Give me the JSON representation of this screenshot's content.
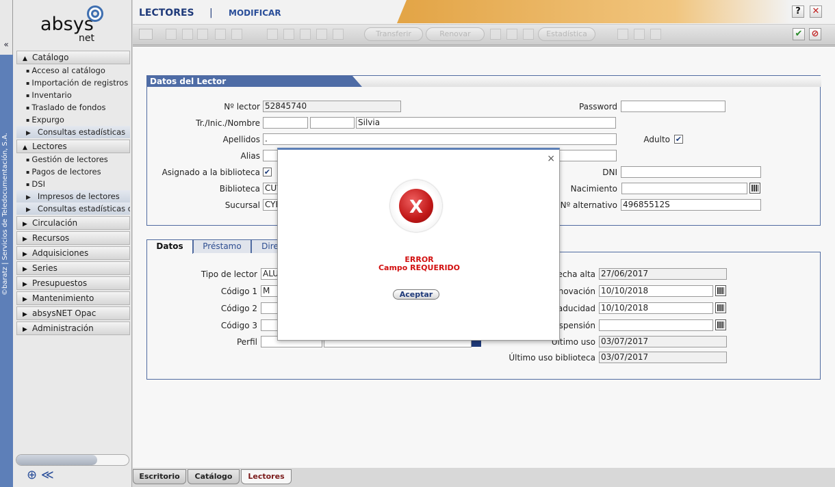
{
  "brand": {
    "name": "absys",
    "suffix": "net",
    "copyright": "©baratz | Servicios de Teledocumentación, S.A."
  },
  "sidebar": {
    "collapse_glyph": "«",
    "sections": [
      {
        "label": "Catálogo",
        "expanded": true,
        "items": [
          {
            "label": "Acceso al catálogo",
            "type": "link"
          },
          {
            "label": "Importación de registros",
            "type": "link"
          },
          {
            "label": "Inventario",
            "type": "link"
          },
          {
            "label": "Traslado de fondos",
            "type": "link"
          },
          {
            "label": "Expurgo",
            "type": "link"
          },
          {
            "label": "Consultas estadísticas",
            "type": "group"
          }
        ]
      },
      {
        "label": "Lectores",
        "expanded": true,
        "items": [
          {
            "label": "Gestión de lectores",
            "type": "link"
          },
          {
            "label": "Pagos de lectores",
            "type": "link"
          },
          {
            "label": "DSI",
            "type": "link"
          },
          {
            "label": "Impresos de lectores",
            "type": "group"
          },
          {
            "label": "Consultas estadísticas d",
            "type": "group"
          }
        ]
      },
      {
        "label": "Circulación",
        "expanded": false
      },
      {
        "label": "Recursos",
        "expanded": false
      },
      {
        "label": "Adquisiciones",
        "expanded": false
      },
      {
        "label": "Series",
        "expanded": false
      },
      {
        "label": "Presupuestos",
        "expanded": false
      },
      {
        "label": "Mantenimiento",
        "expanded": false
      },
      {
        "label": "absysNET Opac",
        "expanded": false
      },
      {
        "label": "Administración",
        "expanded": false
      }
    ]
  },
  "header": {
    "module": "LECTORES",
    "separator": "|",
    "action": "MODIFICAR",
    "help": "?",
    "close": "✕"
  },
  "toolbar": {
    "transferir": "Transferir",
    "renovar": "Renovar",
    "estadistica": "Estadística"
  },
  "lector": {
    "title": "Datos del Lector",
    "n_lector_label": "Nº lector",
    "n_lector": "52845740",
    "password_label": "Password",
    "password": "",
    "nombre_label": "Tr./Inic./Nombre",
    "tr": "",
    "inic": "",
    "nombre": "Silvia",
    "apellidos_label": "Apellidos",
    "apellidos": ".",
    "adulto_label": "Adulto",
    "alias_label": "Alias",
    "alias": "",
    "asignado_label": "Asignado a la biblioteca",
    "dni_label": "DNI",
    "dni": "",
    "biblioteca_label": "Biblioteca",
    "biblioteca": "CUV",
    "nacimiento_label": "Nacimiento",
    "nacimiento": "",
    "sucursal_label": "Sucursal",
    "sucursal": "CYE",
    "n_alt_label": "Nº alternativo",
    "n_alt": "49685512S"
  },
  "tabs": [
    "Datos",
    "Préstamo",
    "Dire"
  ],
  "datos": {
    "tipo_label": "Tipo de lector",
    "tipo": "ALU",
    "codigo1_label": "Código 1",
    "codigo1": "M",
    "codigo2_label": "Código 2",
    "codigo2": "",
    "codigo3_label": "Código 3",
    "codigo3": "",
    "perfil_label": "Perfil",
    "perfil": "",
    "alta_label": "echa alta",
    "alta": "27/06/2017",
    "renov_label": "enovación",
    "renov": "10/10/2018",
    "cad_label": "aducidad",
    "cad": "10/10/2018",
    "susp_label": "spensión",
    "susp": "",
    "uso_label": "Último uso",
    "uso": "03/07/2017",
    "usobib_label": "Último uso biblioteca",
    "usobib": "03/07/2017"
  },
  "bottom_tabs": [
    "Escritorio",
    "Catálogo",
    "Lectores"
  ],
  "dialog": {
    "close": "×",
    "icon_glyph": "X",
    "title": "ERROR",
    "message": "Campo REQUERIDO",
    "ok": "Aceptar"
  },
  "colors": {
    "accent": "#4e6ca6",
    "error": "#d21010",
    "header_gradient": "#e3a547"
  }
}
